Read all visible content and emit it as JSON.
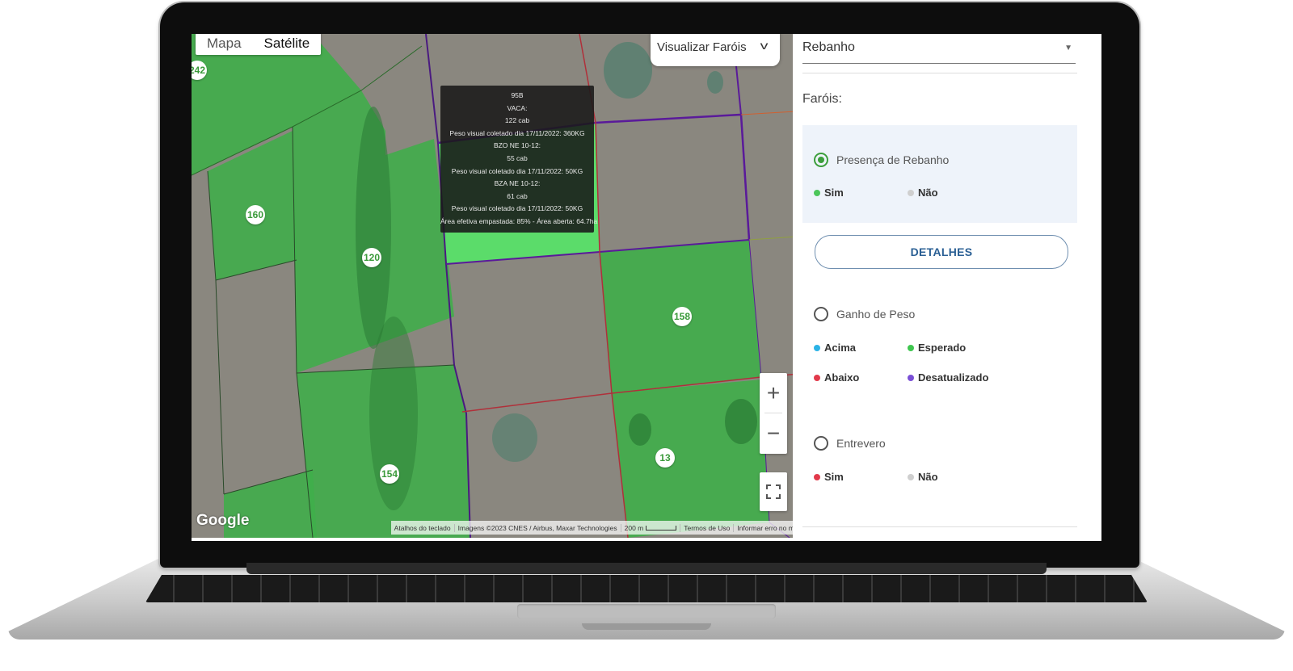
{
  "map": {
    "type_tabs": [
      {
        "label": "Mapa",
        "active": false
      },
      {
        "label": "Satélite",
        "active": true
      }
    ],
    "view_select": {
      "label": "Visualizar Faróis"
    },
    "paddock_badges": [
      "242",
      "160",
      "120",
      "158",
      "154",
      "13"
    ],
    "tooltip": {
      "lines": [
        "95B",
        "VACA:",
        "122 cab",
        "Peso visual coletado dia 17/11/2022: 360KG",
        "BZO NE 10-12:",
        "55 cab",
        "Peso visual coletado dia 17/11/2022: 50KG",
        "BZA NE 10-12:",
        "61 cab",
        "Peso visual coletado dia 17/11/2022: 50KG",
        "Área efetiva empastada: 85% - Área aberta: 64.7ha"
      ]
    },
    "zoom_in": "+",
    "zoom_out": "−",
    "google_logo": "Google",
    "attribution": {
      "shortcuts": "Atalhos do teclado",
      "imagery": "Imagens ©2023 CNES / Airbus, Maxar Technologies",
      "scale": "200 m",
      "terms": "Termos de Uso",
      "report": "Informar erro no mapa"
    }
  },
  "panel": {
    "herd_select": "Rebanho",
    "farois_title": "Faróis:",
    "presenca": {
      "label": "Presença de Rebanho",
      "selected": true,
      "legend": [
        {
          "label": "Sim",
          "color": "#4cc65a"
        },
        {
          "label": "Não",
          "color": "#cfcfcf"
        }
      ]
    },
    "details_button": "DETALHES",
    "ganho": {
      "label": "Ganho de Peso",
      "selected": false,
      "legend": [
        {
          "label": "Acima",
          "color": "#2bb3e6"
        },
        {
          "label": "Esperado",
          "color": "#3fc64f"
        },
        {
          "label": "Abaixo",
          "color": "#e23a4b"
        },
        {
          "label": "Desatualizado",
          "color": "#7a4fd6"
        }
      ]
    },
    "entrevero": {
      "label": "Entrevero",
      "selected": false,
      "legend": [
        {
          "label": "Sim",
          "color": "#e23a4b"
        },
        {
          "label": "Não",
          "color": "#cfcfcf"
        }
      ]
    }
  },
  "colors": {
    "field_green": "#3fae4a",
    "field_highlight": "#5bdc6a",
    "field_gray": "#8b8780",
    "boundary_purple": "#5a1a9a",
    "boundary_red": "#b0303a"
  }
}
